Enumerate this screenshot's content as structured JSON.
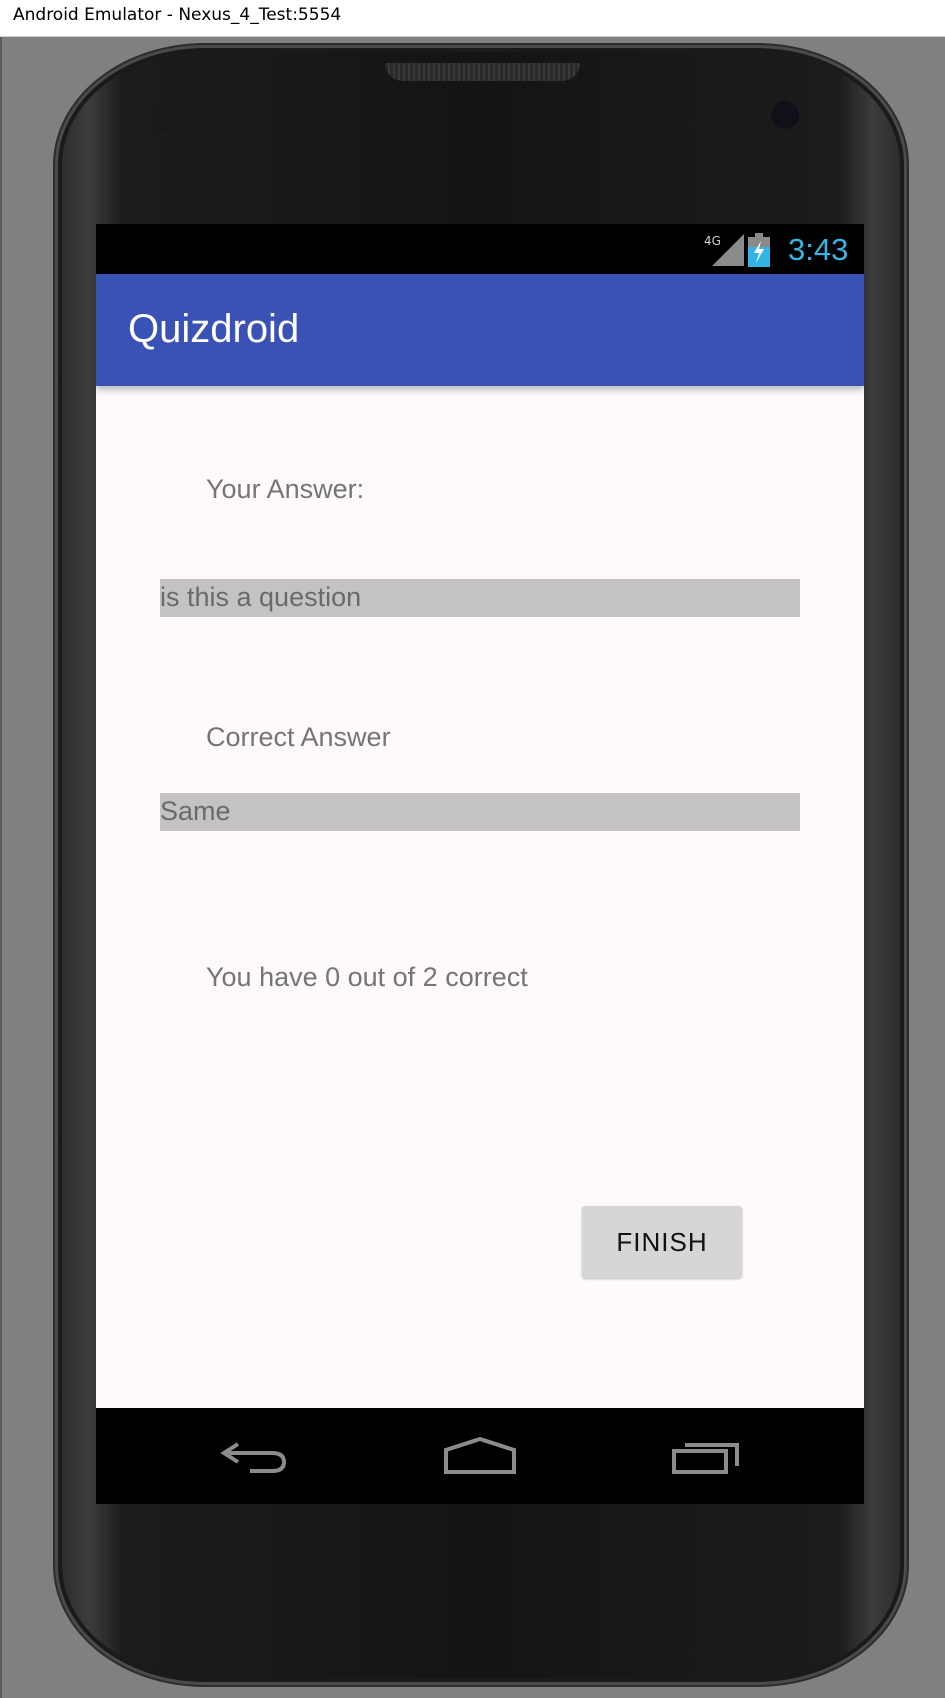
{
  "window": {
    "title": "Android Emulator - Nexus_4_Test:5554"
  },
  "status_bar": {
    "network": "4G",
    "signal_icon": "signal-icon",
    "battery_icon": "battery-charging-icon",
    "time": "3:43",
    "time_color": "#33b5e5"
  },
  "app_bar": {
    "title": "Quizdroid",
    "color": "#3a51b6"
  },
  "content": {
    "your_answer_label": "Your Answer:",
    "your_answer_value": "is this a question",
    "correct_answer_label": "Correct Answer",
    "correct_answer_value": "Same",
    "score_text": "You have 0 out of 2 correct",
    "finish_label": "FINISH"
  },
  "nav_bar": {
    "back_icon": "back-icon",
    "home_icon": "home-icon",
    "recents_icon": "recents-icon"
  }
}
